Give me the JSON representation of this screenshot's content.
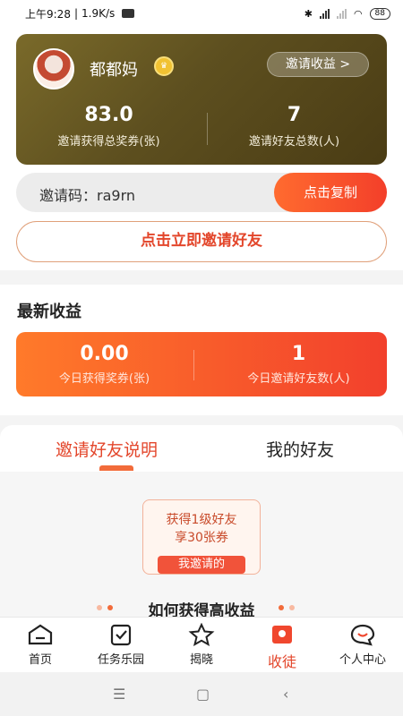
{
  "status_bar": {
    "time": "上午9:28",
    "speed": "1.9K/s",
    "battery": "88"
  },
  "profile": {
    "username": "都都妈",
    "earnings_button": "邀请收益 >",
    "stats": [
      {
        "value": "83.0",
        "label": "邀请获得总奖券(张)"
      },
      {
        "value": "7",
        "label": "邀请好友总数(人)"
      }
    ]
  },
  "invite": {
    "code_label": "邀请码：ra9rn",
    "copy_button": "点击复制",
    "invite_button": "点击立即邀请好友"
  },
  "latest": {
    "title": "最新收益",
    "stats": [
      {
        "value": "0.00",
        "label": "今日获得奖券(张)"
      },
      {
        "value": "1",
        "label": "今日邀请好友数(人)"
      }
    ]
  },
  "tabs": [
    {
      "label": "邀请好友说明",
      "active": true
    },
    {
      "label": "我的好友",
      "active": false
    }
  ],
  "promo": {
    "line1": "获得1级好友",
    "line2": "享30张券",
    "tag": "我邀请的"
  },
  "section_heading": "如何获得高收益",
  "bottom_nav": [
    {
      "label": "首页",
      "icon": "home-icon"
    },
    {
      "label": "任务乐园",
      "icon": "task-clipboard-icon"
    },
    {
      "label": "揭晓",
      "icon": "star-icon"
    },
    {
      "label": "收徒",
      "icon": "ticket-icon",
      "active": true
    },
    {
      "label": "个人中心",
      "icon": "chat-profile-icon"
    }
  ],
  "colors": {
    "accent": "#e3462b",
    "card_gold": "#6b5a22"
  }
}
